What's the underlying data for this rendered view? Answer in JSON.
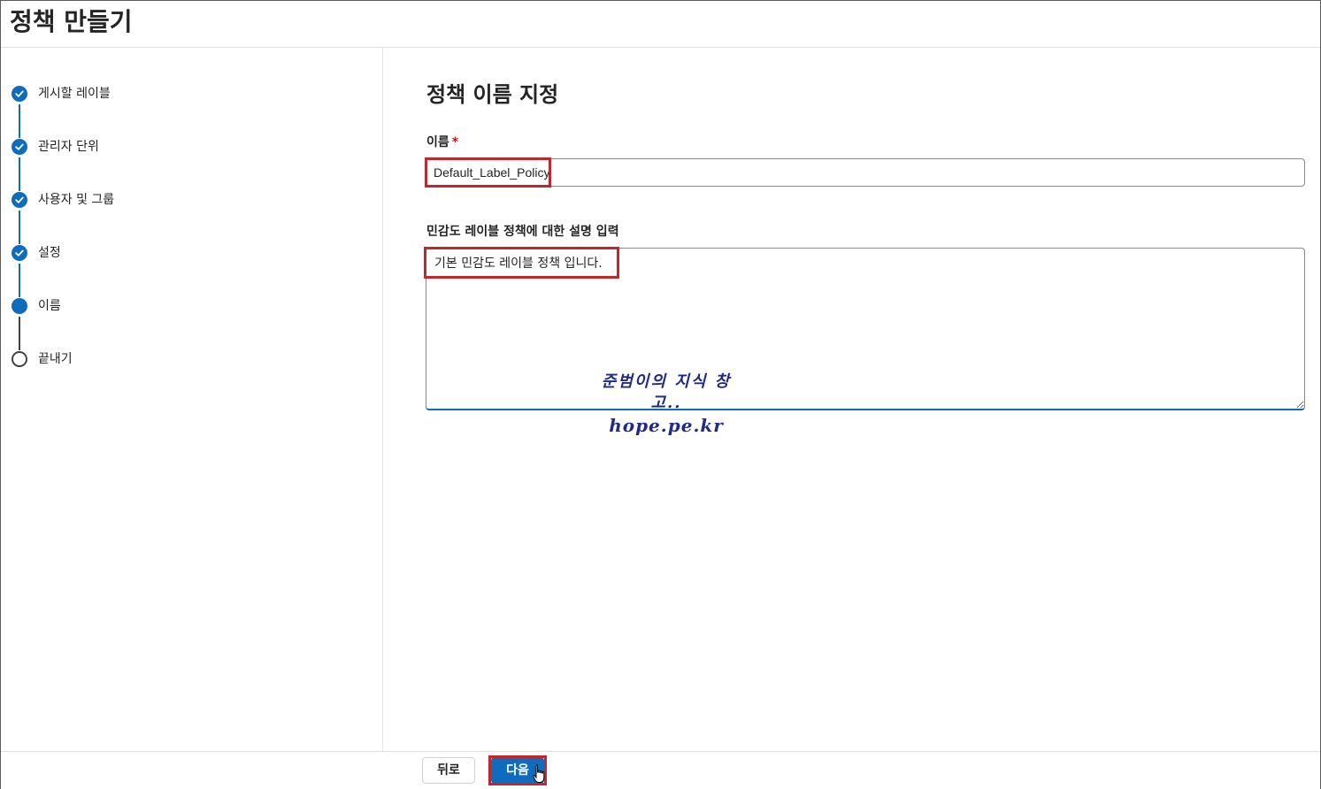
{
  "header": {
    "title": "정책 만들기"
  },
  "wizard": {
    "steps": [
      {
        "label": "게시할 레이블",
        "state": "done"
      },
      {
        "label": "관리자 단위",
        "state": "done"
      },
      {
        "label": "사용자 및 그룹",
        "state": "done"
      },
      {
        "label": "설정",
        "state": "done"
      },
      {
        "label": "이름",
        "state": "current"
      },
      {
        "label": "끝내기",
        "state": "pending"
      }
    ]
  },
  "main": {
    "section_title": "정책 이름 지정",
    "name_label": "이름",
    "required_mark": "*",
    "name_value": "Default_Label_Policy",
    "description_label": "민감도 레이블 정책에 대한 설명 입력",
    "description_value": "기본 민감도 레이블 정책 입니다."
  },
  "watermark": {
    "line1": "준범이의 지식 창고..",
    "line2": "hope.pe.kr"
  },
  "footer": {
    "back_label": "뒤로",
    "next_label": "다음"
  },
  "colors": {
    "accent": "#0f6cbd",
    "highlight": "#c4262e",
    "watermark": "#1f2a8a"
  }
}
